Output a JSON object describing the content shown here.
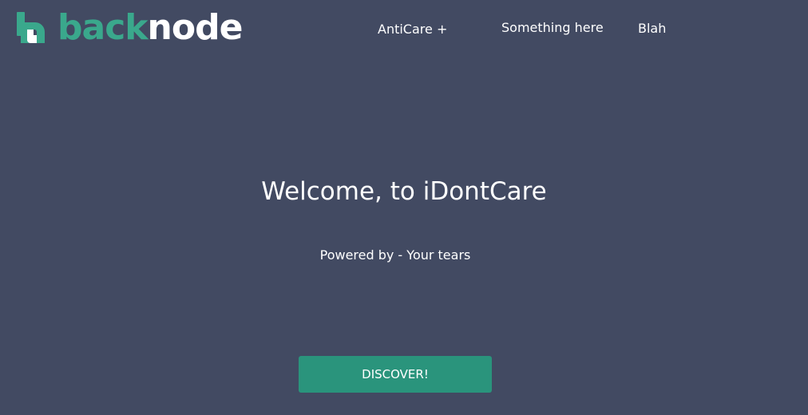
{
  "brand": {
    "part1": "back",
    "part2": "node",
    "accent_color": "#3aa88c"
  },
  "nav": {
    "items": [
      {
        "label": "AntiCare +"
      },
      {
        "label": "Something here"
      },
      {
        "label": "Blah"
      }
    ]
  },
  "hero": {
    "title": "Welcome, to iDontCare",
    "subtitle": "Powered by - Your tears",
    "cta_label": "DISCOVER!",
    "cta_color": "#2a947c"
  },
  "theme": {
    "background": "#424a62"
  }
}
